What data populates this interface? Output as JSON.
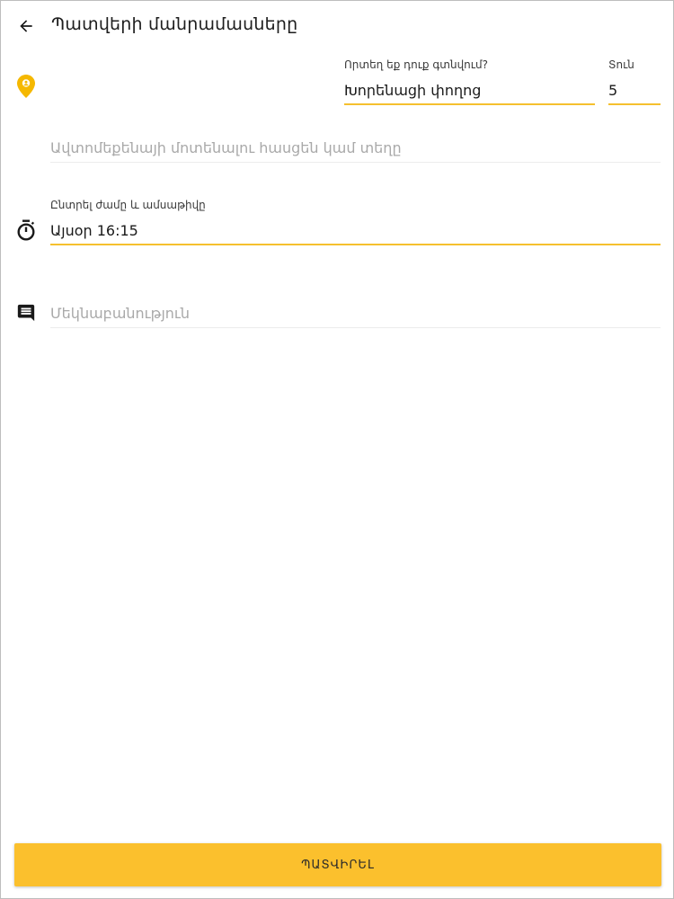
{
  "header": {
    "title": "Պատվերի մանրամասները",
    "back_icon": "arrow-left-icon"
  },
  "location": {
    "icon": "map-pin-icon",
    "icon_color": "#f5b800",
    "address_label": "Որտեղ եք դուք գտնվում?",
    "address_value": "Խորենացի փողոց",
    "house_label": "Տուն",
    "house_value": "5"
  },
  "car_arrival": {
    "placeholder": "Ավտոմեքենայի մոտենալու հասցեն կամ տեղը"
  },
  "datetime": {
    "icon": "timer-icon",
    "label": "Ընտրել ժամը և ամսաթիվը",
    "value": "Այսօր 16:15"
  },
  "comment": {
    "icon": "comment-icon",
    "placeholder": "Մեկնաբանություն"
  },
  "submit": {
    "label": "ՊԱՏՎԻՐԵԼ"
  },
  "colors": {
    "accent": "#fbc02d",
    "underline": "#f5c02e",
    "placeholder": "#a9a9a9"
  }
}
